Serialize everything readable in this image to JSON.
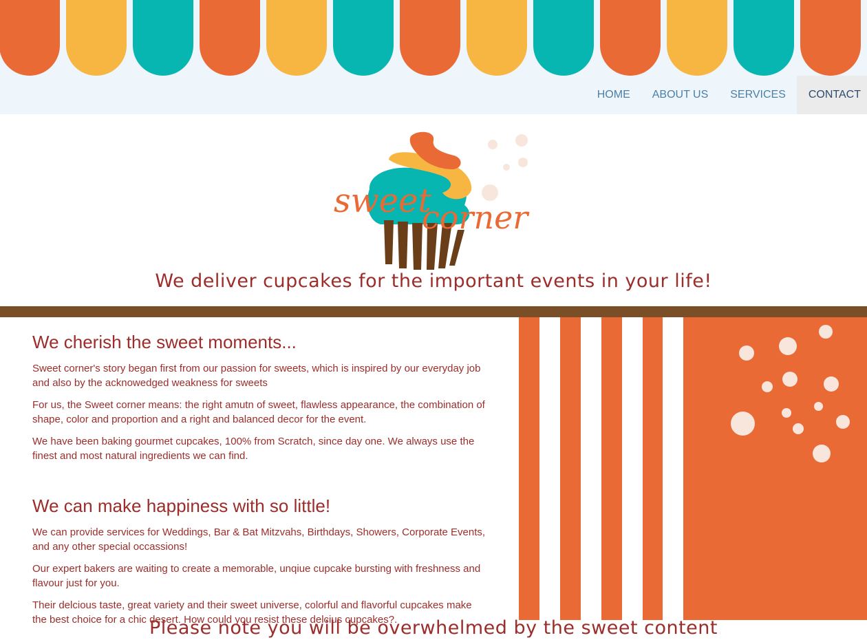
{
  "nav": {
    "items": [
      {
        "label": "HOME"
      },
      {
        "label": "ABOUT US"
      },
      {
        "label": "SERVICES"
      },
      {
        "label": "CONTACT"
      }
    ],
    "active": "CONTACT"
  },
  "logo": {
    "word1": "sweet",
    "word2": "corner"
  },
  "tagline": "We deliver cupcakes for the important events in your life!",
  "sections": [
    {
      "heading": "We cherish the sweet moments...",
      "paragraphs": [
        "Sweet corner's story began first from our passion for sweets, which is inspired by our everyday job and also by the acknowedged weakness for sweets",
        "For us, the Sweet corner means: the right amutn of sweet, flawless appearance, the combination of shape, color and proportion and a right and balanced decor for the event.",
        "We have been baking gourmet cupcakes, 100% from Scratch, since day one. We always use the finest and most natural ingredients we can find."
      ]
    },
    {
      "heading": "We can make happiness with so little!",
      "paragraphs": [
        "We can provide services for Weddings, Bar & Bat Mitzvahs, Birthdays, Showers, Corporate Events, and any other special occassions!",
        "Our expert bakers are waiting to create a memorable, unqiue cupcake bursting with freshness and flavour just for you.",
        "Their delcious taste, great variety and their sweet universe, colorful and flavorful cupcakes make the best choice for a chic desert. How could you resist these delcius cupcakes?."
      ]
    }
  ],
  "footer_note": "Please note you will be overwhelmed by the sweet content",
  "colors": {
    "orange": "#ea6a35",
    "yellow": "#f7b541",
    "teal": "#07b5b1",
    "brown": "#7a4f27",
    "text": "#9b2d2a",
    "nav_text": "#4a7fa8"
  },
  "icons": [
    "cupcake-logo-icon"
  ]
}
